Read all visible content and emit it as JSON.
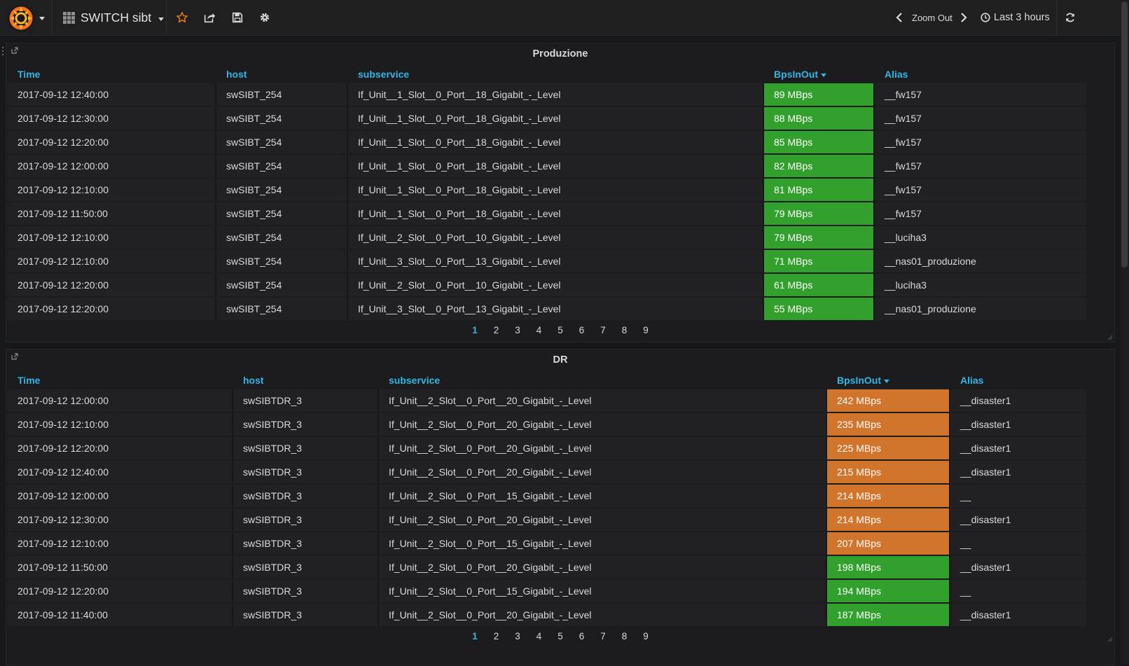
{
  "navbar": {
    "dashboard_title": "SWITCH sibt",
    "zoom_out_label": "Zoom Out",
    "time_range_label": "Last 3 hours",
    "icons": {
      "logo": "grafana-logo",
      "star": "star-icon",
      "share": "share-icon",
      "save": "save-icon",
      "settings": "gear-icon",
      "prev": "chevron-left-icon",
      "next": "chevron-right-icon",
      "clock": "clock-icon",
      "refresh": "refresh-icon"
    },
    "colors": {
      "star": "#eb7b18",
      "accent": "#33b5e5"
    }
  },
  "panels": [
    {
      "title": "Produzione",
      "columns": [
        "Time",
        "host",
        "subservice",
        "BpsInOut",
        "Alias"
      ],
      "sorted_column": "BpsInOut",
      "rows": [
        [
          "2017-09-12 12:40:00",
          "swSIBT_254",
          "If_Unit__1_Slot__0_Port__18_Gigabit_-_Level",
          "89 MBps",
          "__fw157",
          "green"
        ],
        [
          "2017-09-12 12:30:00",
          "swSIBT_254",
          "If_Unit__1_Slot__0_Port__18_Gigabit_-_Level",
          "88 MBps",
          "__fw157",
          "green"
        ],
        [
          "2017-09-12 12:20:00",
          "swSIBT_254",
          "If_Unit__1_Slot__0_Port__18_Gigabit_-_Level",
          "85 MBps",
          "__fw157",
          "green"
        ],
        [
          "2017-09-12 12:00:00",
          "swSIBT_254",
          "If_Unit__1_Slot__0_Port__18_Gigabit_-_Level",
          "82 MBps",
          "__fw157",
          "green"
        ],
        [
          "2017-09-12 12:10:00",
          "swSIBT_254",
          "If_Unit__1_Slot__0_Port__18_Gigabit_-_Level",
          "81 MBps",
          "__fw157",
          "green"
        ],
        [
          "2017-09-12 11:50:00",
          "swSIBT_254",
          "If_Unit__1_Slot__0_Port__18_Gigabit_-_Level",
          "79 MBps",
          "__fw157",
          "green"
        ],
        [
          "2017-09-12 12:10:00",
          "swSIBT_254",
          "If_Unit__2_Slot__0_Port__10_Gigabit_-_Level",
          "79 MBps",
          "__luciha3",
          "green"
        ],
        [
          "2017-09-12 12:10:00",
          "swSIBT_254",
          "If_Unit__3_Slot__0_Port__13_Gigabit_-_Level",
          "71 MBps",
          "__nas01_produzione",
          "green"
        ],
        [
          "2017-09-12 12:20:00",
          "swSIBT_254",
          "If_Unit__2_Slot__0_Port__10_Gigabit_-_Level",
          "61 MBps",
          "__luciha3",
          "green"
        ],
        [
          "2017-09-12 12:20:00",
          "swSIBT_254",
          "If_Unit__3_Slot__0_Port__13_Gigabit_-_Level",
          "55 MBps",
          "__nas01_produzione",
          "green"
        ]
      ],
      "pages": [
        "1",
        "2",
        "3",
        "4",
        "5",
        "6",
        "7",
        "8",
        "9"
      ],
      "current_page": "1"
    },
    {
      "title": "DR",
      "columns": [
        "Time",
        "host",
        "subservice",
        "BpsInOut",
        "Alias"
      ],
      "sorted_column": "BpsInOut",
      "rows": [
        [
          "2017-09-12 12:00:00",
          "swSIBTDR_3",
          "If_Unit__2_Slot__0_Port__20_Gigabit_-_Level",
          "242 MBps",
          "__disaster1",
          "orange"
        ],
        [
          "2017-09-12 12:10:00",
          "swSIBTDR_3",
          "If_Unit__2_Slot__0_Port__20_Gigabit_-_Level",
          "235 MBps",
          "__disaster1",
          "orange"
        ],
        [
          "2017-09-12 12:20:00",
          "swSIBTDR_3",
          "If_Unit__2_Slot__0_Port__20_Gigabit_-_Level",
          "225 MBps",
          "__disaster1",
          "orange"
        ],
        [
          "2017-09-12 12:40:00",
          "swSIBTDR_3",
          "If_Unit__2_Slot__0_Port__20_Gigabit_-_Level",
          "215 MBps",
          "__disaster1",
          "orange"
        ],
        [
          "2017-09-12 12:00:00",
          "swSIBTDR_3",
          "If_Unit__2_Slot__0_Port__15_Gigabit_-_Level",
          "214 MBps",
          "__",
          "orange"
        ],
        [
          "2017-09-12 12:30:00",
          "swSIBTDR_3",
          "If_Unit__2_Slot__0_Port__20_Gigabit_-_Level",
          "214 MBps",
          "__disaster1",
          "orange"
        ],
        [
          "2017-09-12 12:10:00",
          "swSIBTDR_3",
          "If_Unit__2_Slot__0_Port__15_Gigabit_-_Level",
          "207 MBps",
          "__",
          "orange"
        ],
        [
          "2017-09-12 11:50:00",
          "swSIBTDR_3",
          "If_Unit__2_Slot__0_Port__20_Gigabit_-_Level",
          "198 MBps",
          "__disaster1",
          "green"
        ],
        [
          "2017-09-12 12:20:00",
          "swSIBTDR_3",
          "If_Unit__2_Slot__0_Port__15_Gigabit_-_Level",
          "194 MBps",
          "__",
          "green"
        ],
        [
          "2017-09-12 11:40:00",
          "swSIBTDR_3",
          "If_Unit__2_Slot__0_Port__20_Gigabit_-_Level",
          "187 MBps",
          "__disaster1",
          "green"
        ]
      ],
      "pages": [
        "1",
        "2",
        "3",
        "4",
        "5",
        "6",
        "7",
        "8",
        "9"
      ],
      "current_page": "1"
    }
  ],
  "threshold_colors": {
    "green": "#32a02d",
    "orange": "#d2752c"
  }
}
